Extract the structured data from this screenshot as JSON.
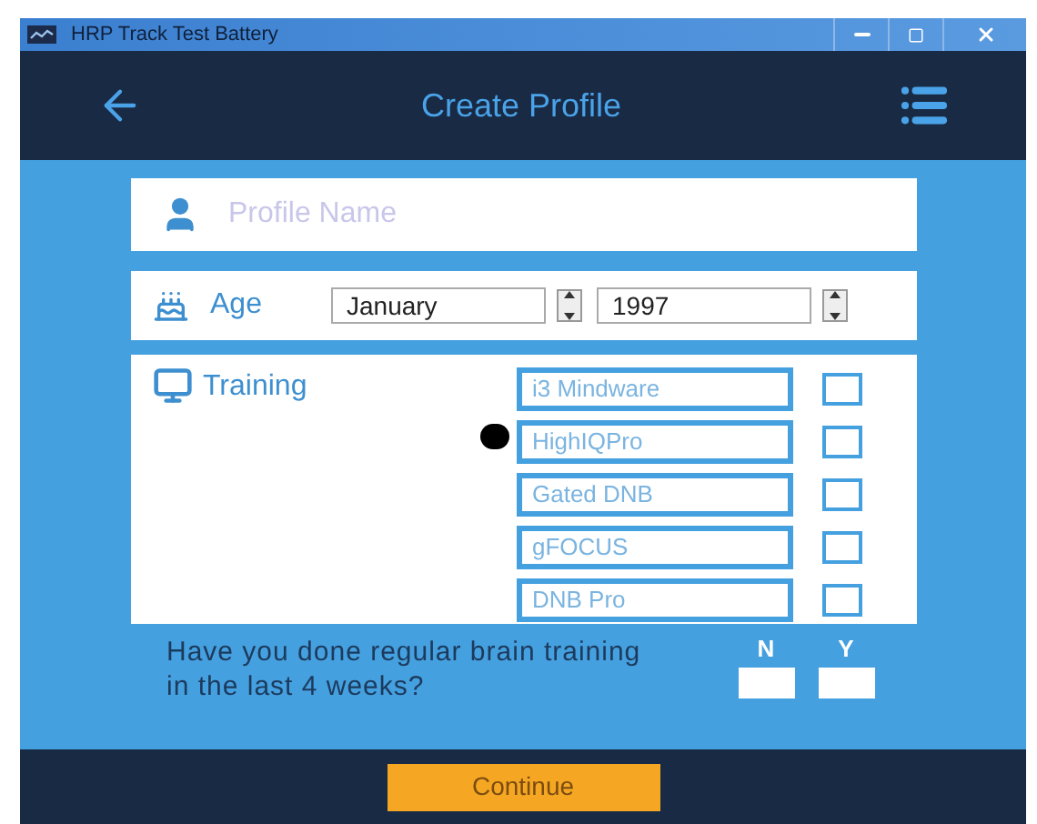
{
  "window": {
    "title": "HRP Track Test Battery"
  },
  "header": {
    "title": "Create Profile"
  },
  "profile_name": {
    "placeholder": "Profile Name"
  },
  "age": {
    "label": "Age",
    "month": "January",
    "year": "1997"
  },
  "training": {
    "label": "Training",
    "options": [
      {
        "label": "i3 Mindware",
        "checked": false
      },
      {
        "label": "HighIQPro",
        "checked": false
      },
      {
        "label": "Gated DNB",
        "checked": false
      },
      {
        "label": "gFOCUS",
        "checked": false
      },
      {
        "label": "DNB Pro",
        "checked": false
      }
    ]
  },
  "question": {
    "text": "Have you done regular brain training in the last 4 weeks?",
    "answers": [
      {
        "label": "N",
        "selected": false
      },
      {
        "label": "Y",
        "selected": false
      }
    ]
  },
  "continue_button": "Continue"
}
